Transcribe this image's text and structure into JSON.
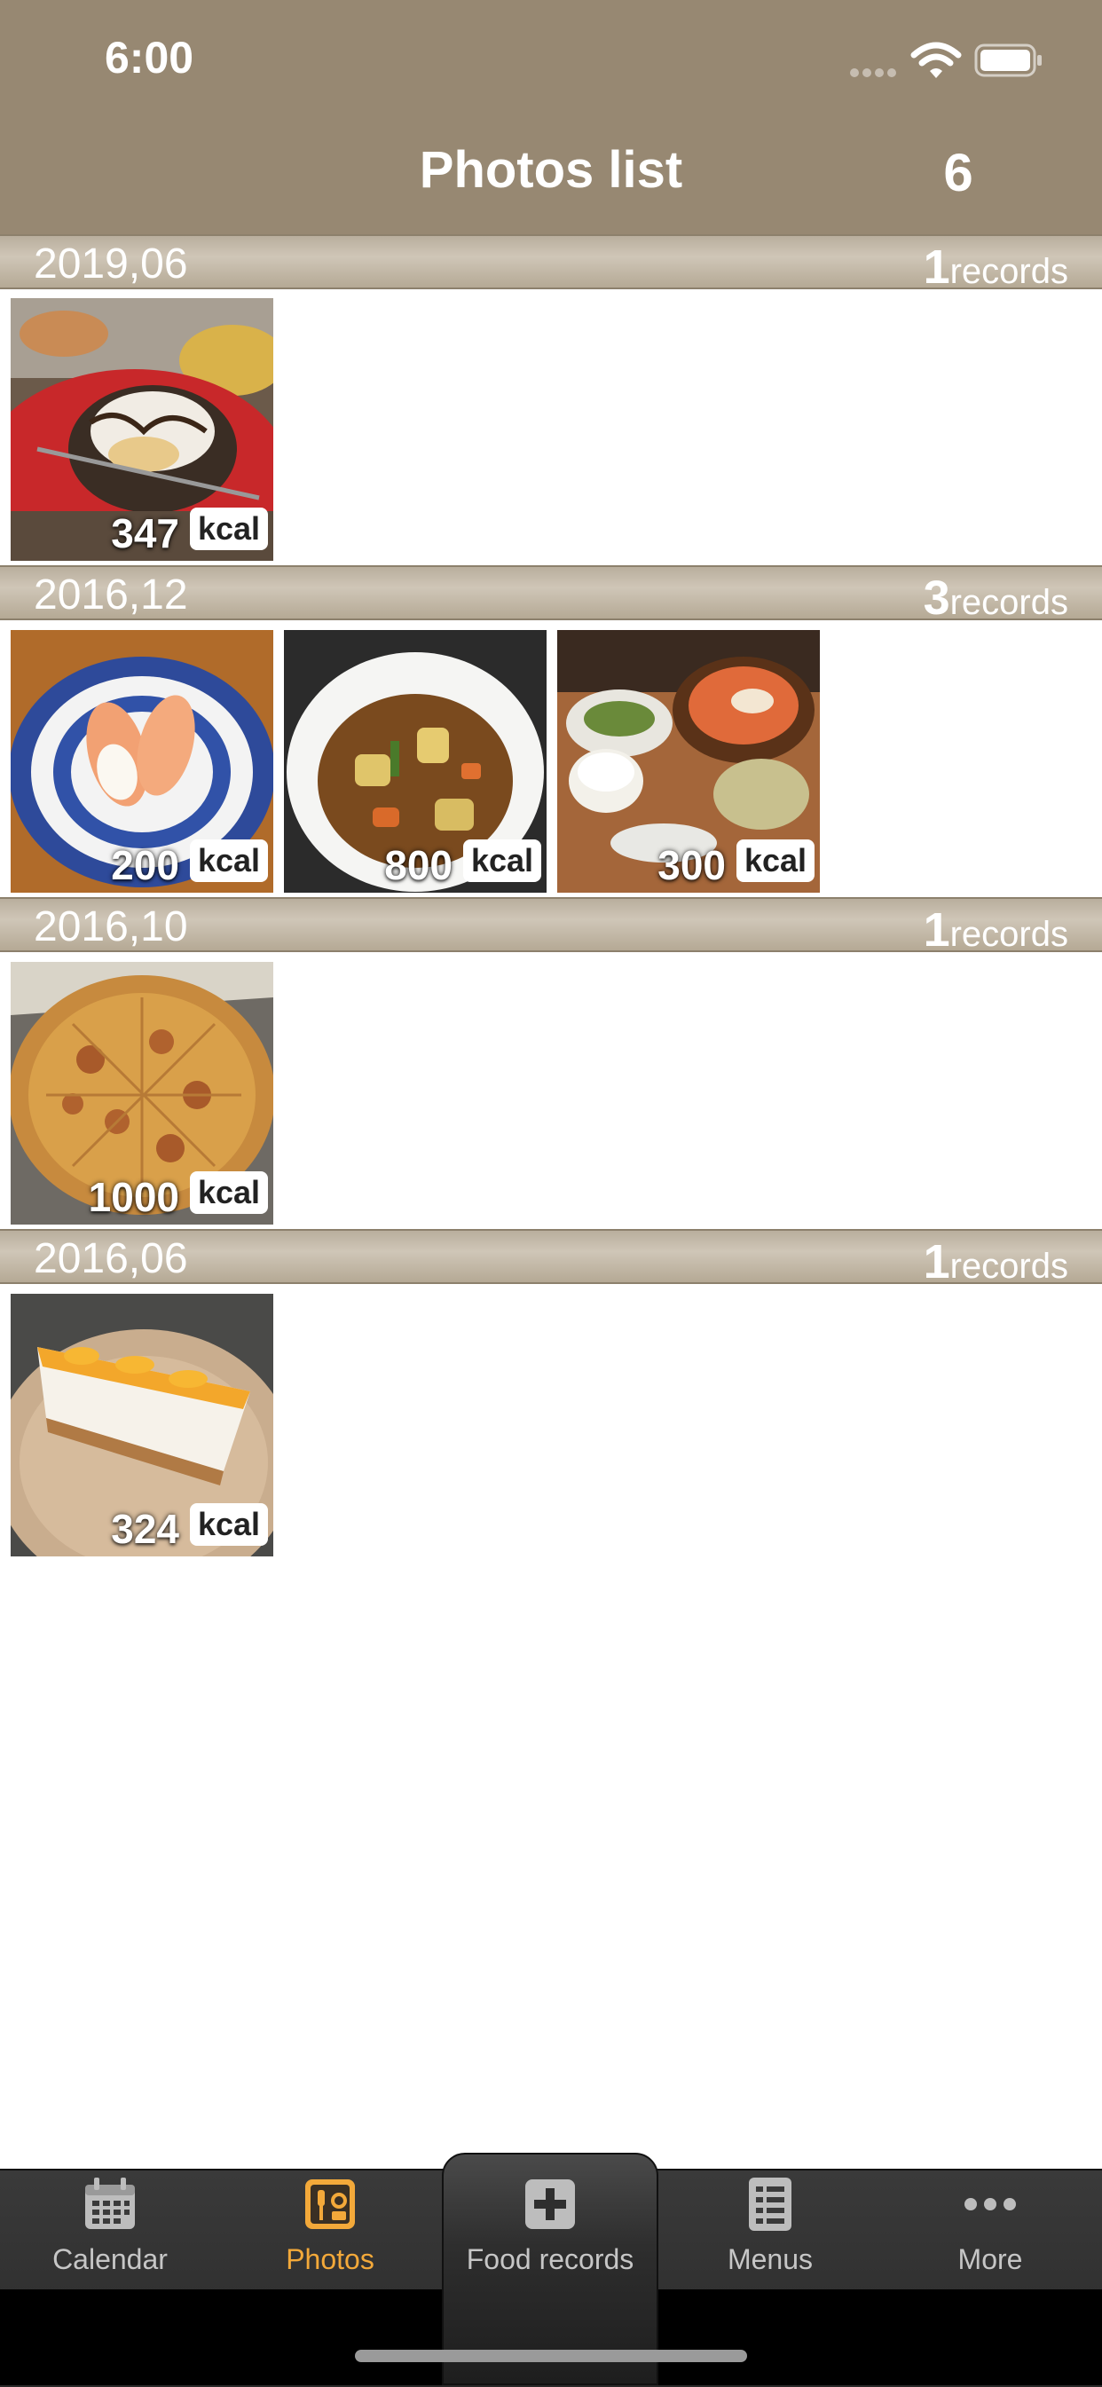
{
  "status_bar": {
    "time": "6:00"
  },
  "nav": {
    "title": "Photos list",
    "count": "6"
  },
  "sections": [
    {
      "date": "2019,06",
      "records_count": "1",
      "records_label": "records",
      "photos": [
        {
          "kcal": "347",
          "unit": "kcal"
        }
      ]
    },
    {
      "date": "2016,12",
      "records_count": "3",
      "records_label": "records",
      "photos": [
        {
          "kcal": "200",
          "unit": "kcal"
        },
        {
          "kcal": "800",
          "unit": "kcal"
        },
        {
          "kcal": "300",
          "unit": "kcal"
        }
      ]
    },
    {
      "date": "2016,10",
      "records_count": "1",
      "records_label": "records",
      "photos": [
        {
          "kcal": "1000",
          "unit": "kcal"
        }
      ]
    },
    {
      "date": "2016,06",
      "records_count": "1",
      "records_label": "records",
      "photos": [
        {
          "kcal": "324",
          "unit": "kcal"
        }
      ]
    }
  ],
  "tabs": [
    {
      "label": "Calendar",
      "icon": "calendar-icon",
      "active": false
    },
    {
      "label": "Photos",
      "icon": "photos-icon",
      "active": true
    },
    {
      "label": "Food records",
      "icon": "plus-icon",
      "active": false
    },
    {
      "label": "Menus",
      "icon": "menu-list-icon",
      "active": false
    },
    {
      "label": "More",
      "icon": "more-dots-icon",
      "active": false
    }
  ],
  "colors": {
    "nav_background": "#978872",
    "active_tab": "#f3a93a",
    "inactive_tab": "#c6c6c6"
  }
}
